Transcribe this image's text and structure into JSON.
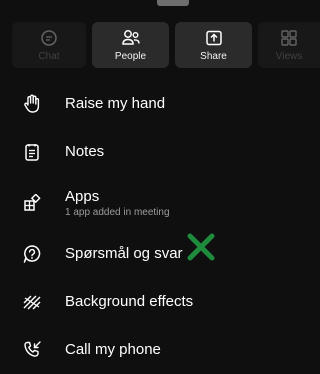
{
  "actions": [
    {
      "label": "Chat",
      "icon": "chat-icon",
      "enabled": false
    },
    {
      "label": "People",
      "icon": "people-icon",
      "enabled": true
    },
    {
      "label": "Share",
      "icon": "share-icon",
      "enabled": true
    },
    {
      "label": "Views",
      "icon": "views-icon",
      "enabled": false
    }
  ],
  "menu": {
    "raise_hand": {
      "label": "Raise my hand",
      "icon": "hand-icon"
    },
    "notes": {
      "label": "Notes",
      "icon": "notes-icon"
    },
    "apps": {
      "label": "Apps",
      "sublabel": "1 app added in meeting",
      "icon": "apps-icon"
    },
    "qa": {
      "label": "Spørsmål og svar",
      "icon": "qa-icon"
    },
    "background": {
      "label": "Background effects",
      "icon": "background-effects-icon"
    },
    "call_phone": {
      "label": "Call my phone",
      "icon": "call-phone-icon"
    }
  },
  "colors": {
    "background": "#0f0f0f",
    "tile": "#2b2b2b",
    "annotation_green": "#1e8a3c"
  }
}
